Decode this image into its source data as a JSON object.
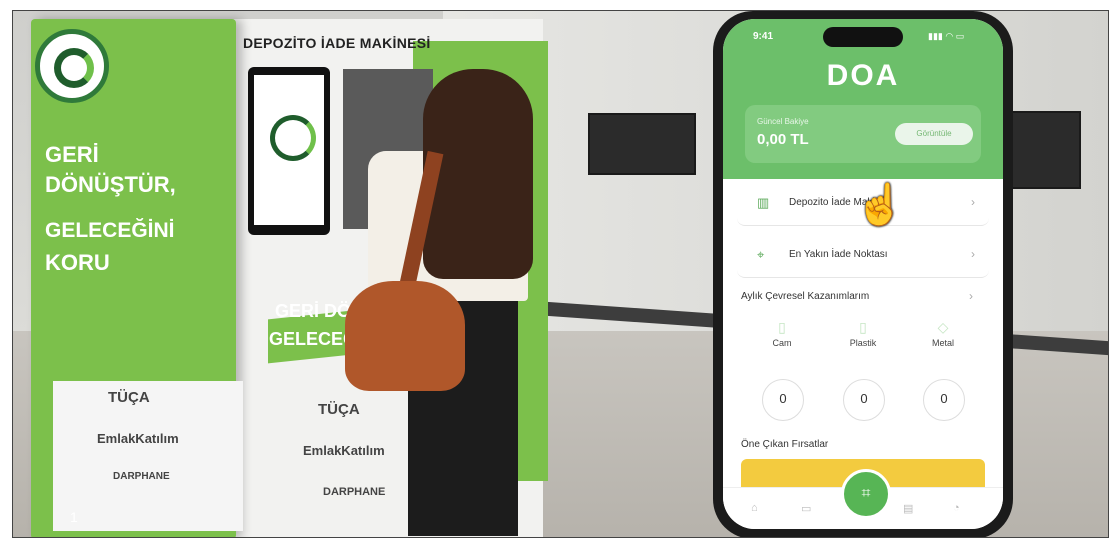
{
  "kiosk": {
    "slogan_line1": "GERİ",
    "slogan_line2": "DÖNÜŞTÜR,",
    "slogan_line3": "GELECEĞİNİ",
    "slogan_line4": "KORU",
    "brand_1": "TÜÇA",
    "brand_2": "EmlakKatılım",
    "brand_3": "DARPHANE"
  },
  "machine": {
    "title": "DEPOZİTO İADE MAKİNESİ",
    "band_line1": "GERİ DÖN",
    "band_line2": "GELECEĞİ",
    "brand_1": "TÜÇA",
    "brand_2": "EmlakKatılım",
    "brand_3": "DARPHANE"
  },
  "phone": {
    "status_time": "9:41",
    "status_icons": "▮▮▮ ◠ ▭",
    "app_logo": "DOA",
    "balance": {
      "label": "Güncel Bakiye",
      "value": "0,00 TL",
      "button": "Görüntüle"
    },
    "menu": [
      {
        "label": "Depozito İade Makini",
        "icon": "recycle-machine-icon"
      },
      {
        "label": "En Yakın İade Noktası",
        "icon": "location-pin-icon"
      }
    ],
    "monthly_title": "Aylık Çevresel Kazanımlarım",
    "stats": [
      {
        "label": "Cam",
        "value": "0"
      },
      {
        "label": "Plastik",
        "value": "0"
      },
      {
        "label": "Metal",
        "value": "0"
      }
    ],
    "opportunities_title": "Öne Çıkan Fırsatlar"
  },
  "page_number": "1",
  "colors": {
    "brand_green": "#7cc04b",
    "app_green": "#6cbf6a",
    "promo_yellow": "#f3cb3f"
  }
}
